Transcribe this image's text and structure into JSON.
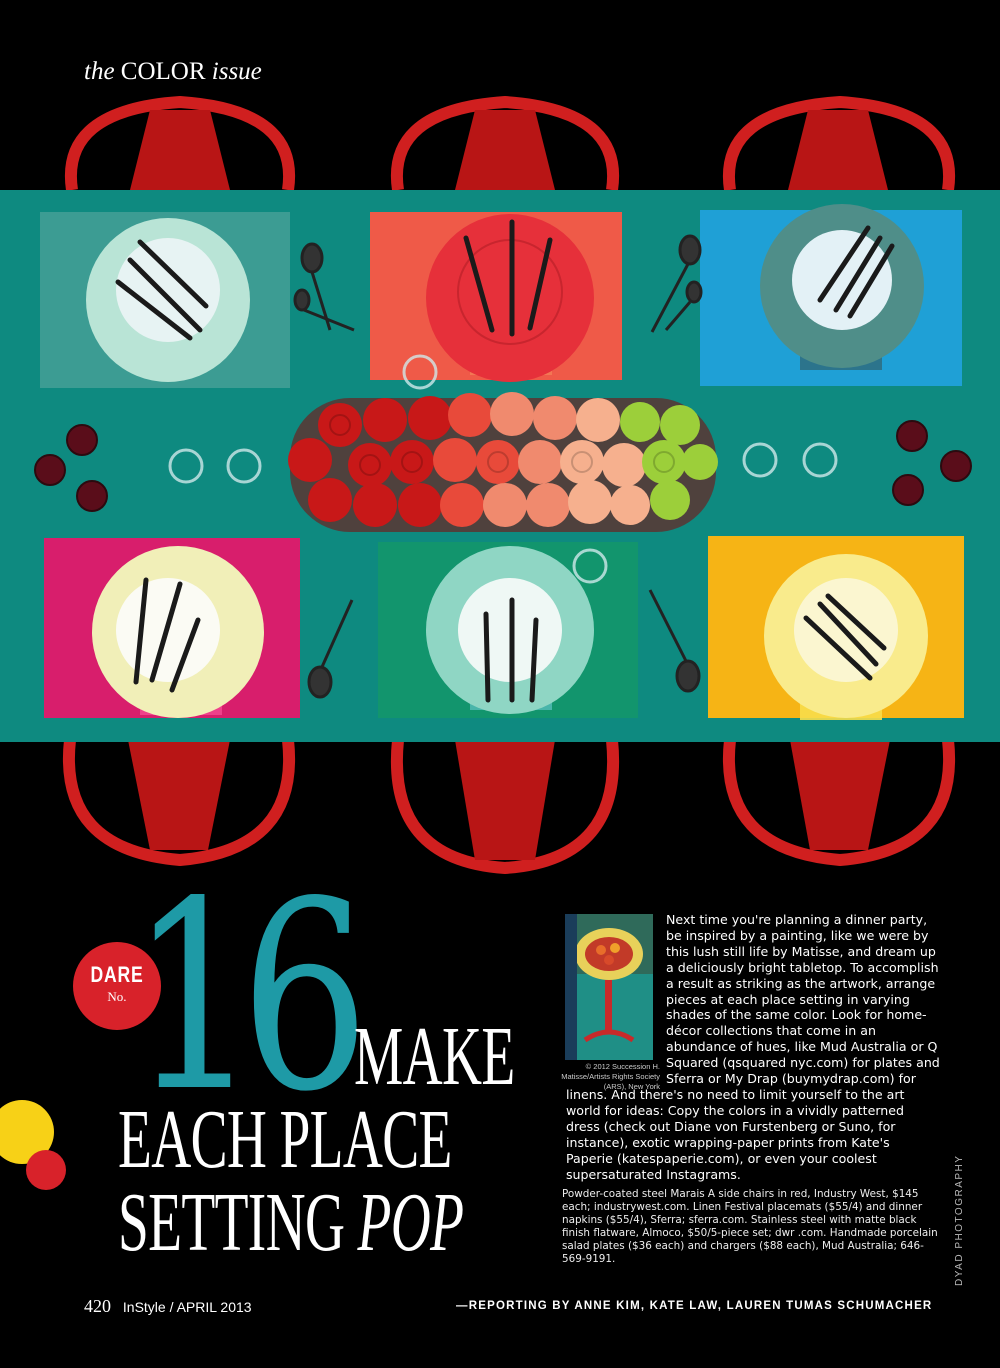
{
  "section": {
    "prefix": "the",
    "main": "COLOR",
    "suffix": "issue"
  },
  "dare": {
    "word": "DARE",
    "no": "No.",
    "number": "16"
  },
  "headline": {
    "line1": "MAKE",
    "line2": "EACH PLACE",
    "line3_a": "SETTING",
    "line3_b": "POP"
  },
  "inset_credit": "© 2012 Succession H. Matisse/Artists Rights Society (ARS), New York",
  "body": "Next time you're planning a dinner party, be inspired by a painting, like we were by this lush still life by Matisse, and dream up a deliciously bright tabletop. To accomplish a result as striking as the artwork, arrange pieces at each place setting in varying shades of the same color. Look for home-décor collections that come in an abundance of hues, like Mud Australia or Q Squared (qsquared nyc.com) for plates and Sferra or My Drap (buymydrap.com) for linens. And there's no need to limit yourself to the art world for ideas: Copy the colors in a vividly patterned dress (check out Diane von Furstenberg or Suno, for instance), exotic wrapping-paper prints from Kate's Paperie (katespaperie.com), or even your coolest supersaturated Instagrams.",
  "sources": "Powder-coated steel Marais A side chairs in red, Industry West, $145 each; industrywest.com. Linen Festival placemats ($55/4) and dinner napkins ($55/4), Sferra; sferra.com. Stainless steel with matte black finish flatware, Almoco, $50/5-piece set; dwr .com. Handmade porcelain salad plates ($36 each) and chargers ($88 each), Mud Australia; 646-569-9191.",
  "footer": {
    "page_number": "420",
    "magazine": "InStyle / APRIL 2013",
    "reporting": "—REPORTING BY ANNE KIM, KATE LAW, LAUREN TUMAS SCHUMACHER",
    "photo_credit": "DYAD PHOTOGRAPHY"
  },
  "colors": {
    "background": "#000000",
    "tablecloth": "#0f8f84",
    "chair": "#d01f1f",
    "number_teal": "#1e9aa6",
    "badge_red": "#d8222a",
    "dot_yellow": "#f7d117",
    "placemats": [
      "#3c9c93",
      "#ef5a48",
      "#1fa0d6",
      "#d81e6c",
      "#12956d",
      "#f6b415"
    ],
    "plates": [
      "#b9e4d6",
      "#e6303a",
      "#4f8e89",
      "#f1efb8",
      "#8fd6c4",
      "#f9eb8c"
    ]
  }
}
